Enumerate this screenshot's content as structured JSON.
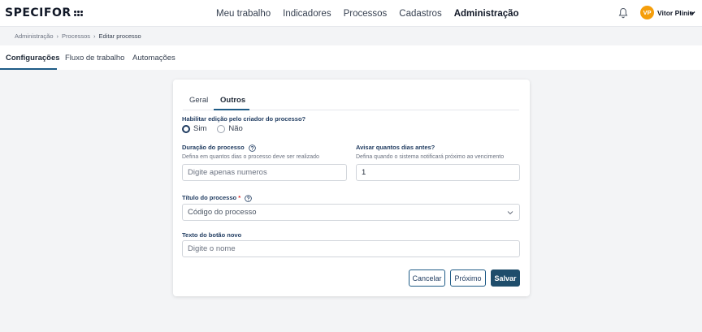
{
  "app": {
    "logo_text": "SPECIFOR",
    "nav": [
      {
        "label": "Meu trabalho"
      },
      {
        "label": "Indicadores"
      },
      {
        "label": "Processos"
      },
      {
        "label": "Cadastros"
      },
      {
        "label": "Administração",
        "active": true
      }
    ],
    "user": {
      "initials": "VP",
      "name": "Vitor Plinio",
      "avatar_color": "#f59e0b"
    }
  },
  "breadcrumb": [
    "Administração",
    "Processos",
    "Editar processo"
  ],
  "subtabs": [
    {
      "label": "Configurações",
      "active": true
    },
    {
      "label": "Fluxo de trabalho"
    },
    {
      "label": "Automações"
    }
  ],
  "card": {
    "tabs": [
      {
        "label": "Geral"
      },
      {
        "label": "Outros",
        "active": true
      }
    ],
    "edit_by_creator": {
      "label": "Habilitar edição pelo criador do processo?",
      "options": [
        {
          "label": "Sim",
          "selected": true
        },
        {
          "label": "Não",
          "selected": false
        }
      ]
    },
    "duration": {
      "label": "Duração do processo",
      "help": "Defina em quantos dias o processo deve ser realizado",
      "placeholder": "Digite apenas numeros",
      "value": ""
    },
    "notify_days": {
      "label": "Avisar quantos dias antes?",
      "help": "Defina quando o sistema notificará próximo ao vencimento",
      "value": "1"
    },
    "process_title": {
      "label": "Título do processo",
      "required_mark": "*",
      "selected": "Código do processo"
    },
    "new_button_text": {
      "label": "Texto do botão novo",
      "placeholder": "Digite o nome",
      "value": ""
    },
    "buttons": {
      "cancel": "Cancelar",
      "next": "Próximo",
      "save": "Salvar"
    }
  },
  "colors": {
    "accent": "#1e5b86",
    "primary_button": "#1e4d6b",
    "label": "#1e3a5f"
  }
}
